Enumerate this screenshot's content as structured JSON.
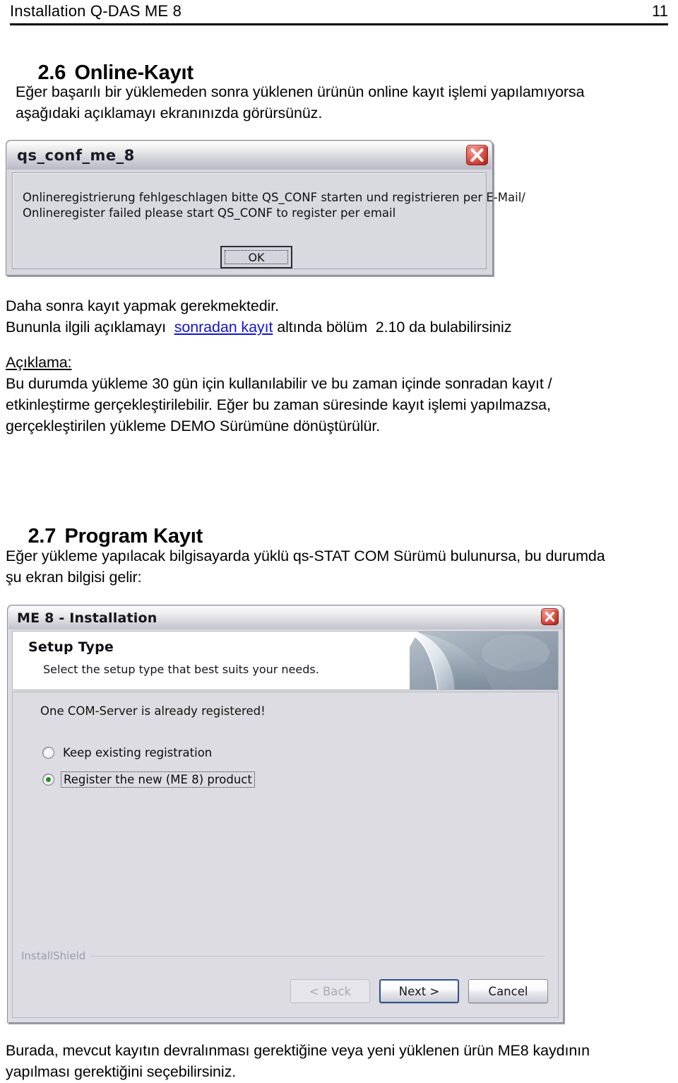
{
  "page": {
    "header_title": "Installation Q-DAS ME 8",
    "page_number": "11"
  },
  "section_26": {
    "number": "2.6",
    "title": "Online-Kayıt",
    "intro_line1": "Eğer başarılı bir yüklemeden sonra yüklenen ürünün online kayıt işlemi yapılamıyorsa",
    "intro_line2": "aşağıdaki açıklamayı ekranınızda görürsünüz."
  },
  "dialog_error": {
    "title": "qs_conf_me_8",
    "close_icon": "close-icon",
    "message_line1": "Onlineregistrierung fehlgeschlagen bitte QS_CONF starten und registrieren per E-Mail/",
    "message_line2": "Onlineregister failed please start QS_CONF to register per email",
    "ok_label": "OK"
  },
  "after_error": {
    "line1": "Daha sonra kayıt yapmak gerekmektedir.",
    "line2_pre": "Bununla ilgili açıklamayı  ",
    "line2_link": "sonradan kayıt",
    "line2_post": " altında bölüm  2.10 da bulabilirsiniz",
    "link_color": "#1414cf"
  },
  "aciklama": {
    "heading": "Açıklama:",
    "line1": "Bu durumda yükleme 30 gün için kullanılabilir ve bu zaman içinde sonradan kayıt /",
    "line2": "etkinleştirme gerçekleştirilebilir. Eğer bu zaman süresinde kayıt işlemi yapılmazsa,",
    "line3": "gerçekleştirilen yükleme DEMO Sürümüne dönüştürülür."
  },
  "section_27": {
    "number": "2.7",
    "title": "Program Kayıt",
    "intro_line1": "Eğer yükleme yapılacak bilgisayarda yüklü qs-STAT COM Sürümü bulunursa, bu durumda",
    "intro_line2": "şu ekran bilgisi gelir:"
  },
  "dialog_installer": {
    "title": "ME 8 - Installation",
    "close_icon": "close-icon",
    "banner_title": "Setup Type",
    "banner_subtitle": "Select the setup type that best suits your needs.",
    "note": "One COM-Server is already registered!",
    "options": [
      {
        "label": "Keep existing registration",
        "selected": false,
        "focused": false
      },
      {
        "label": "Register the new (ME 8) product",
        "selected": true,
        "focused": true
      }
    ],
    "brand": "InstallShield",
    "buttons": [
      {
        "label": "< Back",
        "key": "B",
        "state": "disabled"
      },
      {
        "label": "Next >",
        "key": "N",
        "state": "default"
      },
      {
        "label": "Cancel",
        "key": "",
        "state": "normal"
      }
    ]
  },
  "footer_text": {
    "line1": "Burada, mevcut kayıtın devralınması gerektiğine veya yeni yüklenen ürün ME8 kaydının",
    "line2": "yapılması gerektiğini seçebilirsiniz."
  }
}
